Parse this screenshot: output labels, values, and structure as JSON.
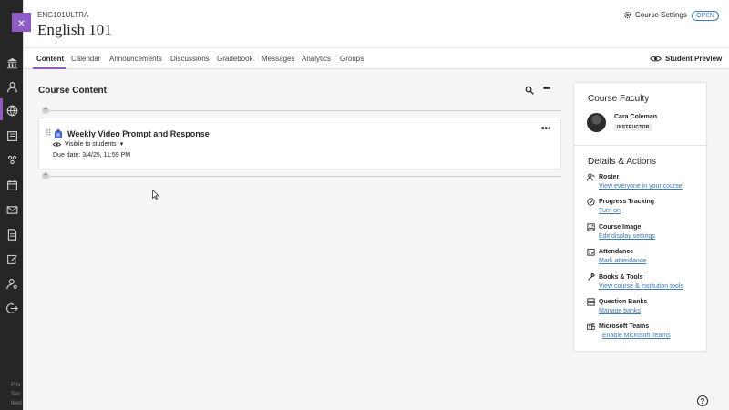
{
  "header": {
    "course_code": "ENG101ULTRA",
    "course_title": "English 101",
    "close_symbol": "×",
    "settings_label": "Course Settings",
    "status_badge": "OPEN"
  },
  "tabs": [
    "Content",
    "Calendar",
    "Announcements",
    "Discussions",
    "Gradebook",
    "Messages",
    "Analytics",
    "Groups"
  ],
  "student_preview_label": "Student Preview",
  "course_content": {
    "title": "Course Content",
    "item": {
      "title": "Weekly Video Prompt and Response",
      "visibility": "Visible to students",
      "due_date": "Due date: 3/4/25, 11:59 PM"
    }
  },
  "sidebar": {
    "faculty_heading": "Course Faculty",
    "faculty_name": "Cara Coleman",
    "faculty_role": "INSTRUCTOR",
    "details_heading": "Details & Actions",
    "actions": [
      {
        "title": "Roster",
        "link": "View everyone in your course",
        "icon": "roster-icon"
      },
      {
        "title": "Progress Tracking",
        "link": "Turn on",
        "icon": "check-circle-icon"
      },
      {
        "title": "Course Image",
        "link": "Edit display settings",
        "icon": "image-icon"
      },
      {
        "title": "Attendance",
        "link": "Mark attendance",
        "icon": "attendance-icon"
      },
      {
        "title": "Books & Tools",
        "link": "View course & institution tools",
        "icon": "tools-icon"
      },
      {
        "title": "Question Banks",
        "link": "Manage banks",
        "icon": "banks-icon"
      },
      {
        "title": "Microsoft Teams",
        "link": "Enable Microsoft Teams",
        "icon": "teams-icon"
      }
    ]
  },
  "left_footer": [
    "Priv",
    "Terr",
    "feed"
  ],
  "help_symbol": "?",
  "colors": {
    "accent": "#8e5ac4",
    "link": "#3f7bb5",
    "nav_bg": "#262626"
  }
}
